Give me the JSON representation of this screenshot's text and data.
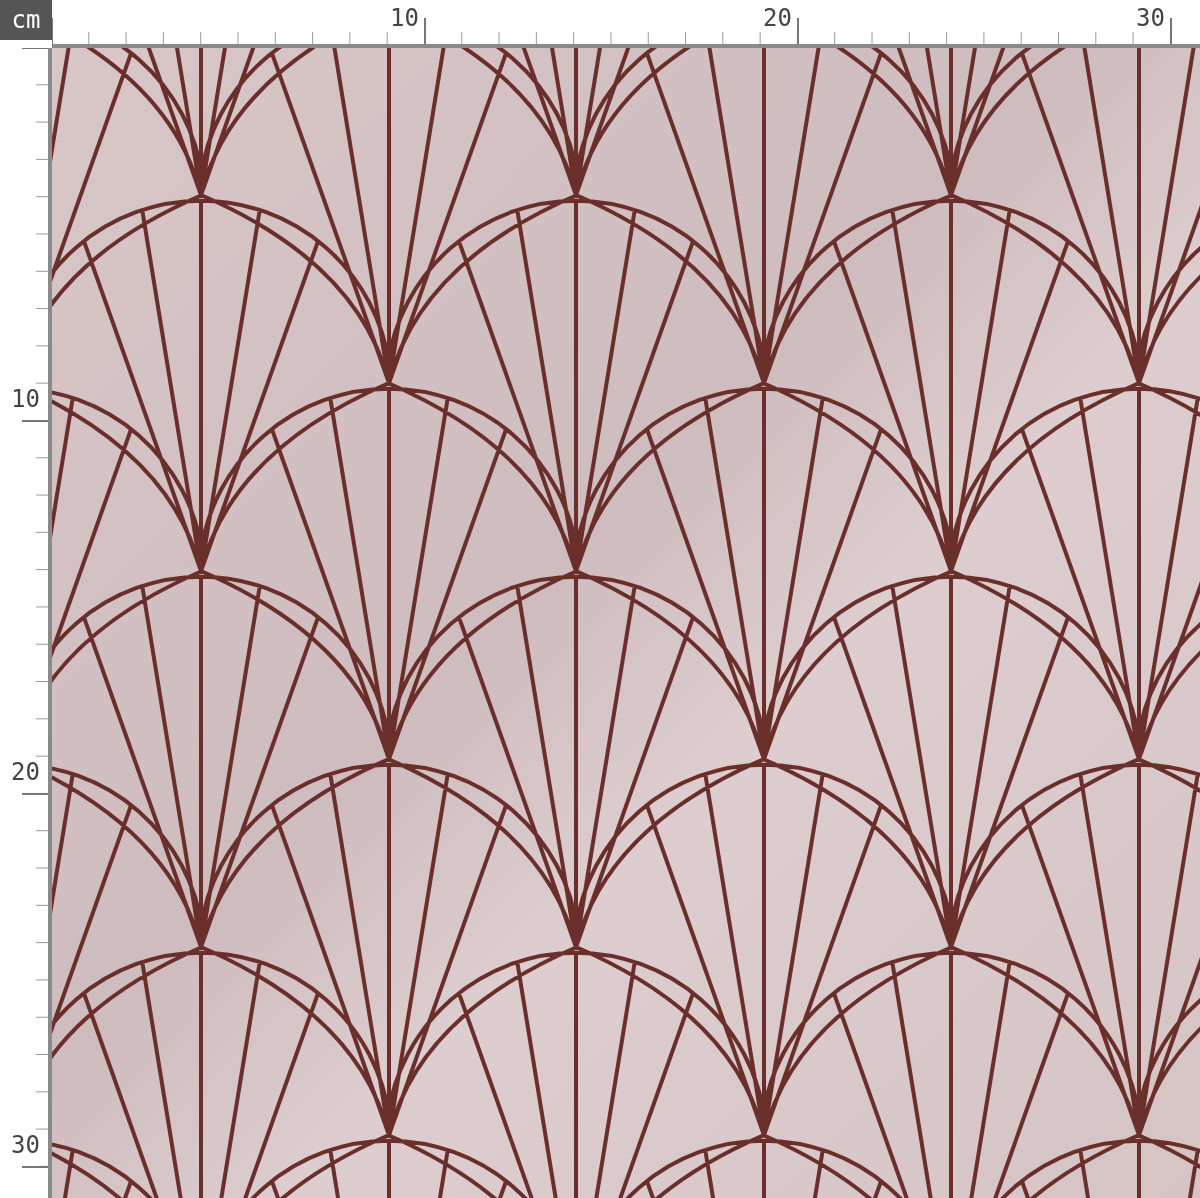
{
  "unit_badge": "cm",
  "top_ruler": {
    "labels": [
      "10",
      "20",
      "30"
    ]
  },
  "left_ruler": {
    "labels": [
      "10",
      "20",
      "30"
    ]
  }
}
